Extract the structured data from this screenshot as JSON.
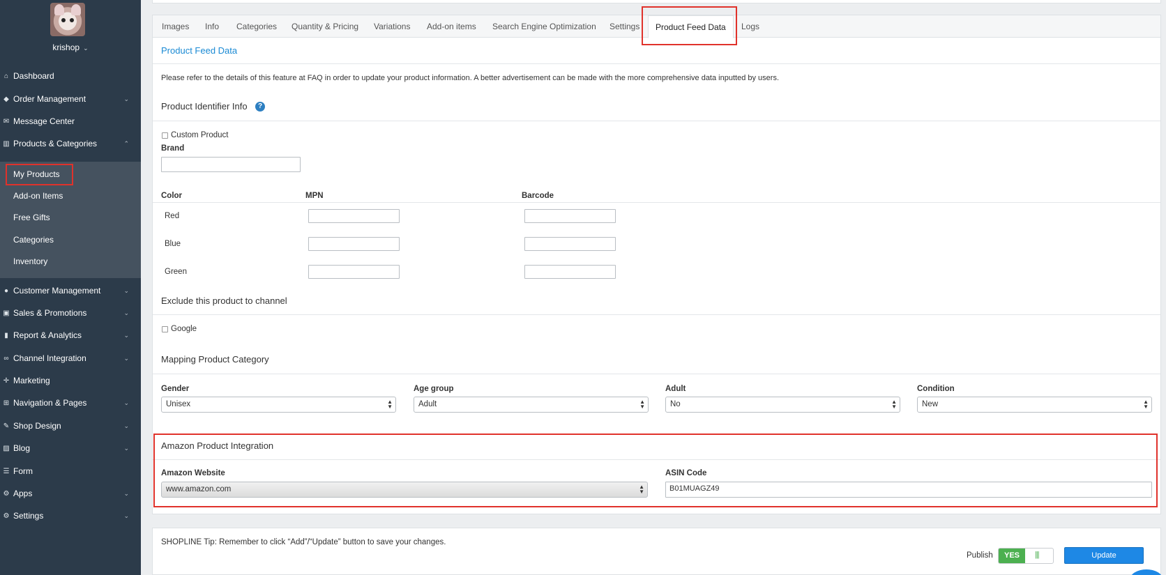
{
  "user": {
    "name": "krishop"
  },
  "sidebar": {
    "items": [
      {
        "label": "Dashboard",
        "icon": "home-icon",
        "has_chevron": false
      },
      {
        "label": "Order Management",
        "icon": "tag-icon",
        "has_chevron": true
      },
      {
        "label": "Message Center",
        "icon": "envelope-icon",
        "has_chevron": false
      },
      {
        "label": "Products & Categories",
        "icon": "barcode-icon",
        "has_chevron": true,
        "expanded": true
      },
      {
        "label": "Customer Management",
        "icon": "users-icon",
        "has_chevron": true
      },
      {
        "label": "Sales & Promotions",
        "icon": "money-icon",
        "has_chevron": true
      },
      {
        "label": "Report & Analytics",
        "icon": "bar-chart-icon",
        "has_chevron": true
      },
      {
        "label": "Channel Integration",
        "icon": "link-icon",
        "has_chevron": true
      },
      {
        "label": "Marketing",
        "icon": "crosshair-icon",
        "has_chevron": false
      },
      {
        "label": "Navigation & Pages",
        "icon": "sitemap-icon",
        "has_chevron": true
      },
      {
        "label": "Shop Design",
        "icon": "brush-icon",
        "has_chevron": true
      },
      {
        "label": "Blog",
        "icon": "edit-icon",
        "has_chevron": true
      },
      {
        "label": "Form",
        "icon": "list-icon",
        "has_chevron": false
      },
      {
        "label": "Apps",
        "icon": "cogs-icon",
        "has_chevron": true
      },
      {
        "label": "Settings",
        "icon": "gear-icon",
        "has_chevron": true
      }
    ],
    "sub_items": [
      "My Products",
      "Add-on Items",
      "Free Gifts",
      "Categories",
      "Inventory"
    ]
  },
  "tabs": [
    "Images",
    "Info",
    "Categories",
    "Quantity & Pricing",
    "Variations",
    "Add-on items",
    "Search Engine Optimization",
    "Settings",
    "Product Feed Data",
    "Logs"
  ],
  "active_tab": "Product Feed Data",
  "page": {
    "title": "Product Feed Data",
    "intro": "Please refer to the details of this feature at FAQ in order to update your product information. A better advertisement can be made with the more comprehensive data inputted by users.",
    "identifier_section": "Product Identifier Info",
    "custom_product_label": "Custom Product",
    "brand_label": "Brand",
    "brand_value": "",
    "variant_headers": {
      "color": "Color",
      "mpn": "MPN",
      "barcode": "Barcode"
    },
    "variants": [
      {
        "color": "Red",
        "mpn": "",
        "barcode": ""
      },
      {
        "color": "Blue",
        "mpn": "",
        "barcode": ""
      },
      {
        "color": "Green",
        "mpn": "",
        "barcode": ""
      }
    ],
    "exclude_section": "Exclude this product to channel",
    "exclude_google_label": "Google",
    "mapping_section": "Mapping Product Category",
    "mapping": {
      "gender_label": "Gender",
      "gender_value": "Unisex",
      "age_label": "Age group",
      "age_value": "Adult",
      "adult_label": "Adult",
      "adult_value": "No",
      "condition_label": "Condition",
      "condition_value": "New"
    },
    "amazon_section": "Amazon Product Integration",
    "amazon": {
      "website_label": "Amazon Website",
      "website_value": "www.amazon.com",
      "asin_label": "ASIN Code",
      "asin_value": "B01MUAGZ49"
    }
  },
  "footer": {
    "tip": "SHOPLINE Tip: Remember to click “Add”/“Update” button to save your changes.",
    "publish_label": "Publish",
    "publish_yes": "YES",
    "update_label": "Update"
  },
  "colors": {
    "sidebar": "#2c3b4a",
    "highlight": "#e0322b",
    "accent": "#1e88e5",
    "publish_green": "#4cb050",
    "title_blue": "#1a8ad4"
  }
}
